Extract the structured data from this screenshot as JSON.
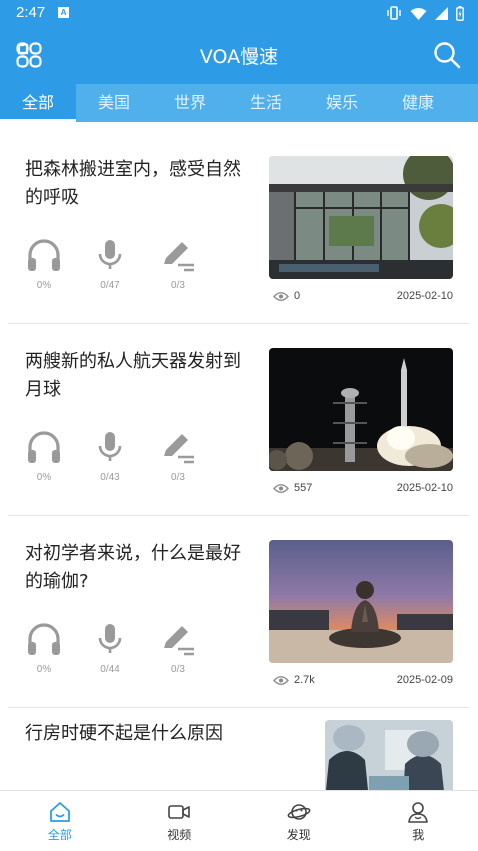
{
  "status_bar": {
    "time": "2:47",
    "notification_letter": "A"
  },
  "app": {
    "title": "VOA慢速"
  },
  "tabs": [
    {
      "label": "全部",
      "active": true
    },
    {
      "label": "美国",
      "active": false
    },
    {
      "label": "世界",
      "active": false
    },
    {
      "label": "生活",
      "active": false
    },
    {
      "label": "娱乐",
      "active": false
    },
    {
      "label": "健康",
      "active": false
    }
  ],
  "articles": [
    {
      "title": "把森林搬进室内，感受自然的呼吸",
      "listen": "0%",
      "speak": "0/47",
      "write": "0/3",
      "views": "0",
      "date": "2025-02-10",
      "image": "modern-glass-house-image"
    },
    {
      "title": "两艘新的私人航天器发射到月球",
      "listen": "0%",
      "speak": "0/43",
      "write": "0/3",
      "views": "557",
      "date": "2025-02-10",
      "image": "rocket-launch-night-image"
    },
    {
      "title": "对初学者来说，什么是最好的瑜伽?",
      "listen": "0%",
      "speak": "0/44",
      "write": "0/3",
      "views": "2.7k",
      "date": "2025-02-09",
      "image": "yoga-beach-sunset-image"
    },
    {
      "title": "行房时硬不起是什么原因",
      "image": "surgeons-operating-image"
    }
  ],
  "bottom_nav": [
    {
      "label": "全部",
      "icon": "home-icon",
      "active": true
    },
    {
      "label": "视频",
      "icon": "video-camera-icon",
      "active": false
    },
    {
      "label": "发现",
      "icon": "planet-icon",
      "active": false
    },
    {
      "label": "我",
      "icon": "user-icon",
      "active": false
    }
  ],
  "colors": {
    "primary": "#2e9be6",
    "tab_bar": "#4fb0ec",
    "icon_gray": "#9a9a9a",
    "active_nav": "#2e9be6"
  }
}
